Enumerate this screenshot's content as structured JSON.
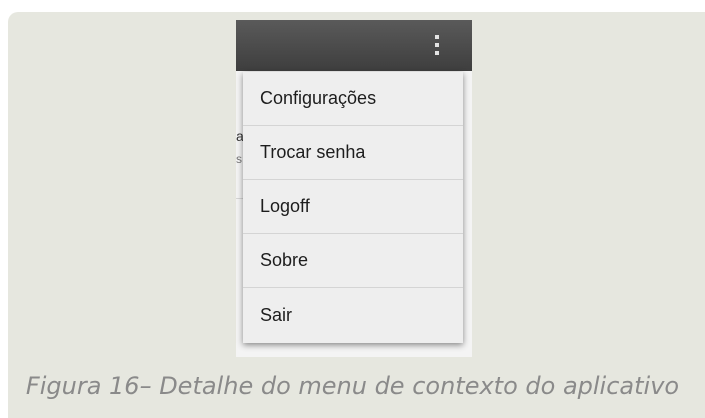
{
  "menu": {
    "items": [
      {
        "label": "Configurações"
      },
      {
        "label": "Trocar senha"
      },
      {
        "label": "Logoff"
      },
      {
        "label": "Sobre"
      },
      {
        "label": "Sair"
      }
    ]
  },
  "background": {
    "fragment_1": "a",
    "fragment_2": "s"
  },
  "caption": "Figura 16– Detalhe do menu de contexto do aplicativo",
  "icons": {
    "overflow": "overflow-menu-icon"
  },
  "colors": {
    "action_bar": "#4a4a4a",
    "menu_background": "#eeeeee",
    "frame_background": "#e6e7df"
  }
}
